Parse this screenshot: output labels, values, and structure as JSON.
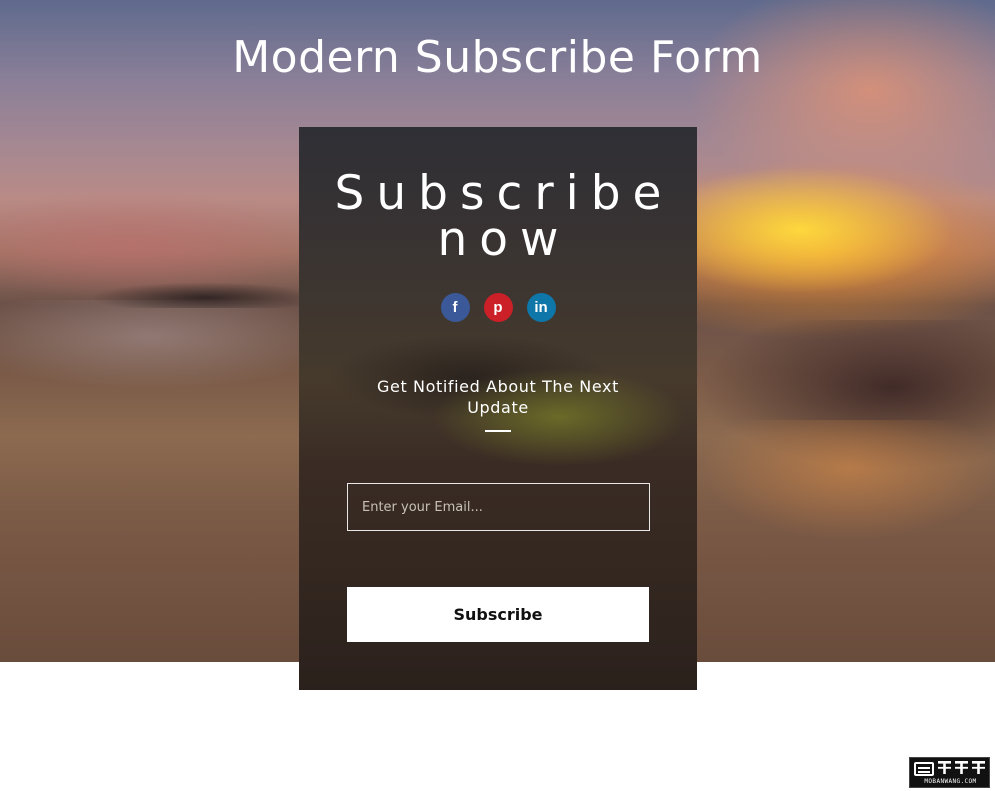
{
  "page": {
    "title": "Modern Subscribe Form"
  },
  "card": {
    "heading_line1": "Subscribe",
    "heading_line2": "now",
    "social": [
      {
        "name": "facebook",
        "glyph": "f",
        "icon": "facebook-icon",
        "color": "#3b5998"
      },
      {
        "name": "pinterest",
        "glyph": "p",
        "icon": "pinterest-icon",
        "color": "#cb2027"
      },
      {
        "name": "linkedin",
        "glyph": "in",
        "icon": "linkedin-icon",
        "color": "#0e76a8"
      }
    ],
    "notify_text": "Get Notified About The Next Update",
    "email_placeholder": "Enter your Email...",
    "email_value": "",
    "subscribe_label": "Subscribe"
  },
  "watermark": {
    "logo_text": "MOBANWANG.COM",
    "logo_cn": "模板王"
  }
}
